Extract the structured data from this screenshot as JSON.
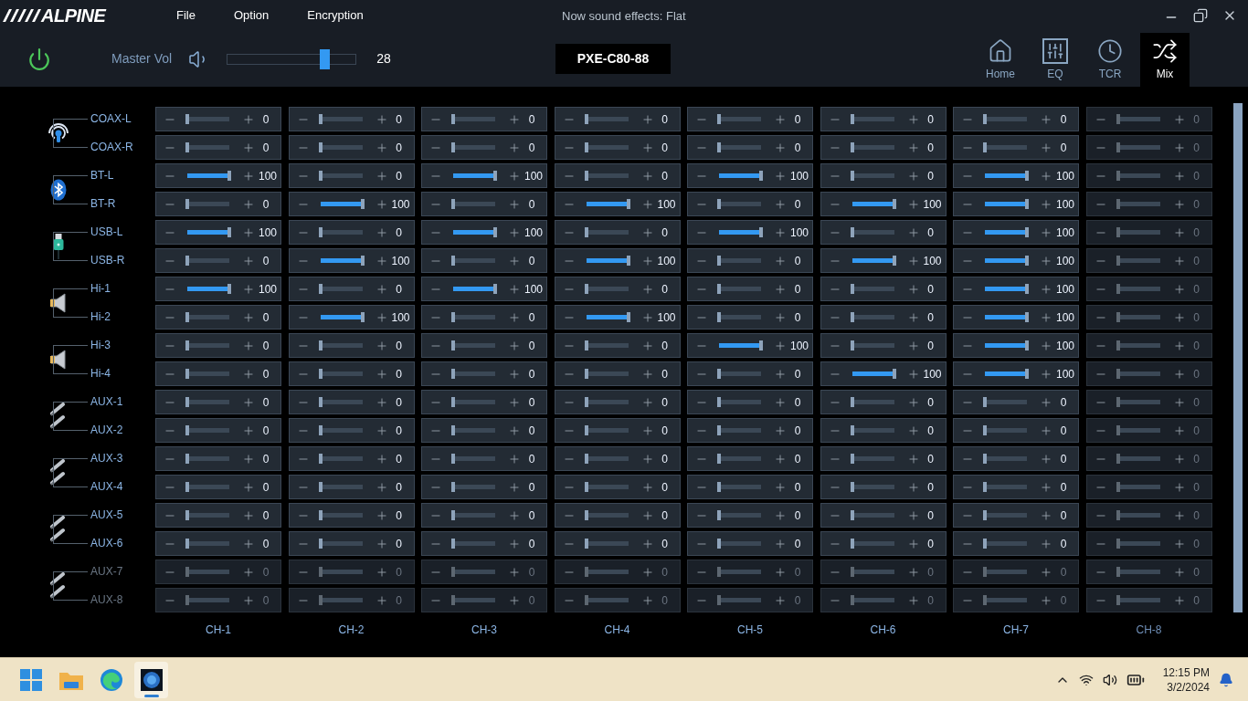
{
  "app": {
    "logo": "ALPINE",
    "menu": [
      "File",
      "Option",
      "Encryption"
    ],
    "title": "Now sound effects: Flat"
  },
  "toolbar": {
    "master": {
      "label": "Master Vol",
      "level": 0.78,
      "value": "28"
    },
    "device": "PXE-C80-88",
    "tabs": [
      {
        "label": "Home",
        "kind": "home",
        "selected": false
      },
      {
        "label": "EQ",
        "kind": "eq",
        "selected": false
      },
      {
        "label": "TCR",
        "kind": "tcr",
        "selected": false
      },
      {
        "label": "Mix",
        "kind": "mix",
        "selected": true
      }
    ]
  },
  "columns": [
    {
      "label": "CH-1",
      "disabled": false
    },
    {
      "label": "CH-2",
      "disabled": false
    },
    {
      "label": "CH-3",
      "disabled": false
    },
    {
      "label": "CH-4",
      "disabled": false
    },
    {
      "label": "CH-5",
      "disabled": false
    },
    {
      "label": "CH-6",
      "disabled": false
    },
    {
      "label": "CH-7",
      "disabled": false
    },
    {
      "label": "CH-8",
      "disabled": true
    }
  ],
  "groups": [
    {
      "kind": "coax",
      "rows": [
        {
          "label": "COAX-L",
          "disabled": false,
          "cells": [
            {
              "level": 0,
              "value": "0"
            },
            {
              "level": 0,
              "value": "0"
            },
            {
              "level": 0,
              "value": "0"
            },
            {
              "level": 0,
              "value": "0"
            },
            {
              "level": 0,
              "value": "0"
            },
            {
              "level": 0,
              "value": "0"
            },
            {
              "level": 0,
              "value": "0"
            },
            {
              "level": 0,
              "value": "0"
            }
          ]
        },
        {
          "label": "COAX-R",
          "disabled": false,
          "cells": [
            {
              "level": 0,
              "value": "0"
            },
            {
              "level": 0,
              "value": "0"
            },
            {
              "level": 0,
              "value": "0"
            },
            {
              "level": 0,
              "value": "0"
            },
            {
              "level": 0,
              "value": "0"
            },
            {
              "level": 0,
              "value": "0"
            },
            {
              "level": 0,
              "value": "0"
            },
            {
              "level": 0,
              "value": "0"
            }
          ]
        }
      ]
    },
    {
      "kind": "bluetooth",
      "rows": [
        {
          "label": "BT-L",
          "disabled": false,
          "cells": [
            {
              "level": 1,
              "value": "100"
            },
            {
              "level": 0,
              "value": "0"
            },
            {
              "level": 1,
              "value": "100"
            },
            {
              "level": 0,
              "value": "0"
            },
            {
              "level": 1,
              "value": "100"
            },
            {
              "level": 0,
              "value": "0"
            },
            {
              "level": 1,
              "value": "100"
            },
            {
              "level": 0,
              "value": "0"
            }
          ]
        },
        {
          "label": "BT-R",
          "disabled": false,
          "cells": [
            {
              "level": 0,
              "value": "0"
            },
            {
              "level": 1,
              "value": "100"
            },
            {
              "level": 0,
              "value": "0"
            },
            {
              "level": 1,
              "value": "100"
            },
            {
              "level": 0,
              "value": "0"
            },
            {
              "level": 1,
              "value": "100"
            },
            {
              "level": 1,
              "value": "100"
            },
            {
              "level": 0,
              "value": "0"
            }
          ]
        }
      ]
    },
    {
      "kind": "usb",
      "rows": [
        {
          "label": "USB-L",
          "disabled": false,
          "cells": [
            {
              "level": 1,
              "value": "100"
            },
            {
              "level": 0,
              "value": "0"
            },
            {
              "level": 1,
              "value": "100"
            },
            {
              "level": 0,
              "value": "0"
            },
            {
              "level": 1,
              "value": "100"
            },
            {
              "level": 0,
              "value": "0"
            },
            {
              "level": 1,
              "value": "100"
            },
            {
              "level": 0,
              "value": "0"
            }
          ]
        },
        {
          "label": "USB-R",
          "disabled": false,
          "cells": [
            {
              "level": 0,
              "value": "0"
            },
            {
              "level": 1,
              "value": "100"
            },
            {
              "level": 0,
              "value": "0"
            },
            {
              "level": 1,
              "value": "100"
            },
            {
              "level": 0,
              "value": "0"
            },
            {
              "level": 1,
              "value": "100"
            },
            {
              "level": 1,
              "value": "100"
            },
            {
              "level": 0,
              "value": "0"
            }
          ]
        }
      ]
    },
    {
      "kind": "speaker",
      "rows": [
        {
          "label": "Hi-1",
          "disabled": false,
          "cells": [
            {
              "level": 1,
              "value": "100"
            },
            {
              "level": 0,
              "value": "0"
            },
            {
              "level": 1,
              "value": "100"
            },
            {
              "level": 0,
              "value": "0"
            },
            {
              "level": 0,
              "value": "0"
            },
            {
              "level": 0,
              "value": "0"
            },
            {
              "level": 1,
              "value": "100"
            },
            {
              "level": 0,
              "value": "0"
            }
          ]
        },
        {
          "label": "Hi-2",
          "disabled": false,
          "cells": [
            {
              "level": 0,
              "value": "0"
            },
            {
              "level": 1,
              "value": "100"
            },
            {
              "level": 0,
              "value": "0"
            },
            {
              "level": 1,
              "value": "100"
            },
            {
              "level": 0,
              "value": "0"
            },
            {
              "level": 0,
              "value": "0"
            },
            {
              "level": 1,
              "value": "100"
            },
            {
              "level": 0,
              "value": "0"
            }
          ]
        }
      ]
    },
    {
      "kind": "speaker",
      "rows": [
        {
          "label": "Hi-3",
          "disabled": false,
          "cells": [
            {
              "level": 0,
              "value": "0"
            },
            {
              "level": 0,
              "value": "0"
            },
            {
              "level": 0,
              "value": "0"
            },
            {
              "level": 0,
              "value": "0"
            },
            {
              "level": 1,
              "value": "100"
            },
            {
              "level": 0,
              "value": "0"
            },
            {
              "level": 1,
              "value": "100"
            },
            {
              "level": 0,
              "value": "0"
            }
          ]
        },
        {
          "label": "Hi-4",
          "disabled": false,
          "cells": [
            {
              "level": 0,
              "value": "0"
            },
            {
              "level": 0,
              "value": "0"
            },
            {
              "level": 0,
              "value": "0"
            },
            {
              "level": 0,
              "value": "0"
            },
            {
              "level": 0,
              "value": "0"
            },
            {
              "level": 1,
              "value": "100"
            },
            {
              "level": 1,
              "value": "100"
            },
            {
              "level": 0,
              "value": "0"
            }
          ]
        }
      ]
    },
    {
      "kind": "aux",
      "rows": [
        {
          "label": "AUX-1",
          "disabled": false,
          "cells": [
            {
              "level": 0,
              "value": "0"
            },
            {
              "level": 0,
              "value": "0"
            },
            {
              "level": 0,
              "value": "0"
            },
            {
              "level": 0,
              "value": "0"
            },
            {
              "level": 0,
              "value": "0"
            },
            {
              "level": 0,
              "value": "0"
            },
            {
              "level": 0,
              "value": "0"
            },
            {
              "level": 0,
              "value": "0"
            }
          ]
        },
        {
          "label": "AUX-2",
          "disabled": false,
          "cells": [
            {
              "level": 0,
              "value": "0"
            },
            {
              "level": 0,
              "value": "0"
            },
            {
              "level": 0,
              "value": "0"
            },
            {
              "level": 0,
              "value": "0"
            },
            {
              "level": 0,
              "value": "0"
            },
            {
              "level": 0,
              "value": "0"
            },
            {
              "level": 0,
              "value": "0"
            },
            {
              "level": 0,
              "value": "0"
            }
          ]
        }
      ]
    },
    {
      "kind": "aux",
      "rows": [
        {
          "label": "AUX-3",
          "disabled": false,
          "cells": [
            {
              "level": 0,
              "value": "0"
            },
            {
              "level": 0,
              "value": "0"
            },
            {
              "level": 0,
              "value": "0"
            },
            {
              "level": 0,
              "value": "0"
            },
            {
              "level": 0,
              "value": "0"
            },
            {
              "level": 0,
              "value": "0"
            },
            {
              "level": 0,
              "value": "0"
            },
            {
              "level": 0,
              "value": "0"
            }
          ]
        },
        {
          "label": "AUX-4",
          "disabled": false,
          "cells": [
            {
              "level": 0,
              "value": "0"
            },
            {
              "level": 0,
              "value": "0"
            },
            {
              "level": 0,
              "value": "0"
            },
            {
              "level": 0,
              "value": "0"
            },
            {
              "level": 0,
              "value": "0"
            },
            {
              "level": 0,
              "value": "0"
            },
            {
              "level": 0,
              "value": "0"
            },
            {
              "level": 0,
              "value": "0"
            }
          ]
        }
      ]
    },
    {
      "kind": "aux",
      "rows": [
        {
          "label": "AUX-5",
          "disabled": false,
          "cells": [
            {
              "level": 0,
              "value": "0"
            },
            {
              "level": 0,
              "value": "0"
            },
            {
              "level": 0,
              "value": "0"
            },
            {
              "level": 0,
              "value": "0"
            },
            {
              "level": 0,
              "value": "0"
            },
            {
              "level": 0,
              "value": "0"
            },
            {
              "level": 0,
              "value": "0"
            },
            {
              "level": 0,
              "value": "0"
            }
          ]
        },
        {
          "label": "AUX-6",
          "disabled": false,
          "cells": [
            {
              "level": 0,
              "value": "0"
            },
            {
              "level": 0,
              "value": "0"
            },
            {
              "level": 0,
              "value": "0"
            },
            {
              "level": 0,
              "value": "0"
            },
            {
              "level": 0,
              "value": "0"
            },
            {
              "level": 0,
              "value": "0"
            },
            {
              "level": 0,
              "value": "0"
            },
            {
              "level": 0,
              "value": "0"
            }
          ]
        }
      ]
    },
    {
      "kind": "aux",
      "rows": [
        {
          "label": "AUX-7",
          "disabled": true,
          "cells": [
            {
              "level": 0,
              "value": "0"
            },
            {
              "level": 0,
              "value": "0"
            },
            {
              "level": 0,
              "value": "0"
            },
            {
              "level": 0,
              "value": "0"
            },
            {
              "level": 0,
              "value": "0"
            },
            {
              "level": 0,
              "value": "0"
            },
            {
              "level": 0,
              "value": "0"
            },
            {
              "level": 0,
              "value": "0"
            }
          ]
        },
        {
          "label": "AUX-8",
          "disabled": true,
          "cells": [
            {
              "level": 0,
              "value": "0"
            },
            {
              "level": 0,
              "value": "0"
            },
            {
              "level": 0,
              "value": "0"
            },
            {
              "level": 0,
              "value": "0"
            },
            {
              "level": 0,
              "value": "0"
            },
            {
              "level": 0,
              "value": "0"
            },
            {
              "level": 0,
              "value": "0"
            },
            {
              "level": 0,
              "value": "0"
            }
          ]
        }
      ]
    }
  ],
  "taskbar": {
    "apps": [
      {
        "kind": "start",
        "selected": false
      },
      {
        "kind": "folder",
        "selected": false
      },
      {
        "kind": "browser",
        "selected": false
      },
      {
        "kind": "app",
        "selected": true
      }
    ],
    "time": "12:15 PM",
    "date": "3/2/2024"
  }
}
